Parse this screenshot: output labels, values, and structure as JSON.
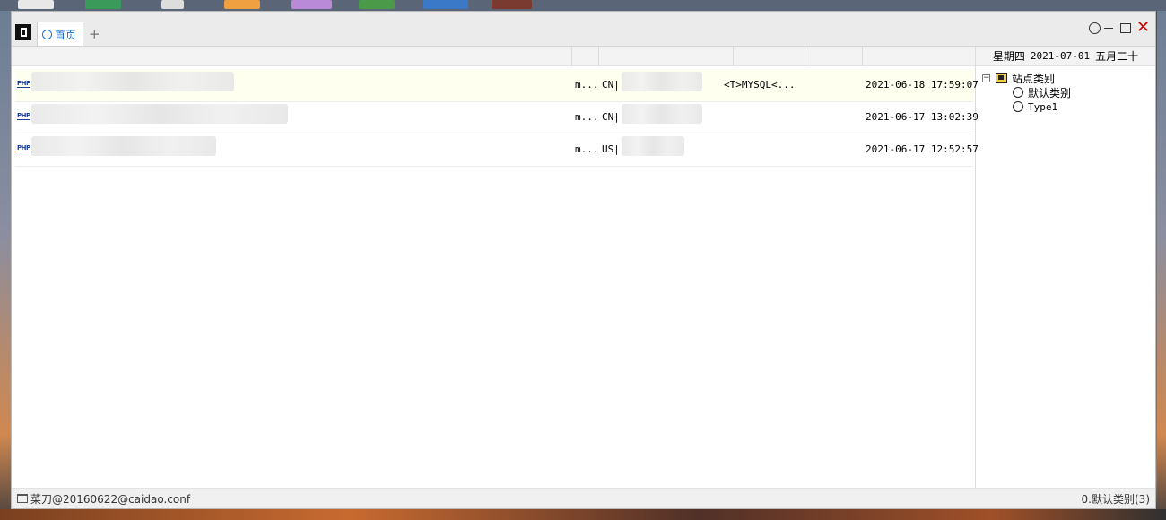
{
  "tabs": [
    {
      "label": "首页"
    }
  ],
  "add_tab": "+",
  "window_controls": {
    "close": "✕"
  },
  "date_bar": {
    "weekday": "星期四",
    "date": "2021-07-01",
    "lunar": "五月二十"
  },
  "rows": [
    {
      "icon": "PHP",
      "type": "m...",
      "ip": "CN|",
      "note": "<T>MYSQL<...",
      "time": "2021-06-18 17:59:07"
    },
    {
      "icon": "PHP",
      "type": "m...",
      "ip": "CN|",
      "note": "",
      "time": "2021-06-17 13:02:39"
    },
    {
      "icon": "PHP",
      "type": "m...",
      "ip": "US|",
      "note": "",
      "time": "2021-06-17 12:52:57"
    }
  ],
  "tree": {
    "expander": "−",
    "root_label": "站点类别",
    "children": [
      {
        "label": "默认类别"
      },
      {
        "label": "Type1"
      }
    ]
  },
  "status": {
    "config": "菜刀@20160622@caidao.conf",
    "category_count": "0.默认类别(3)"
  }
}
